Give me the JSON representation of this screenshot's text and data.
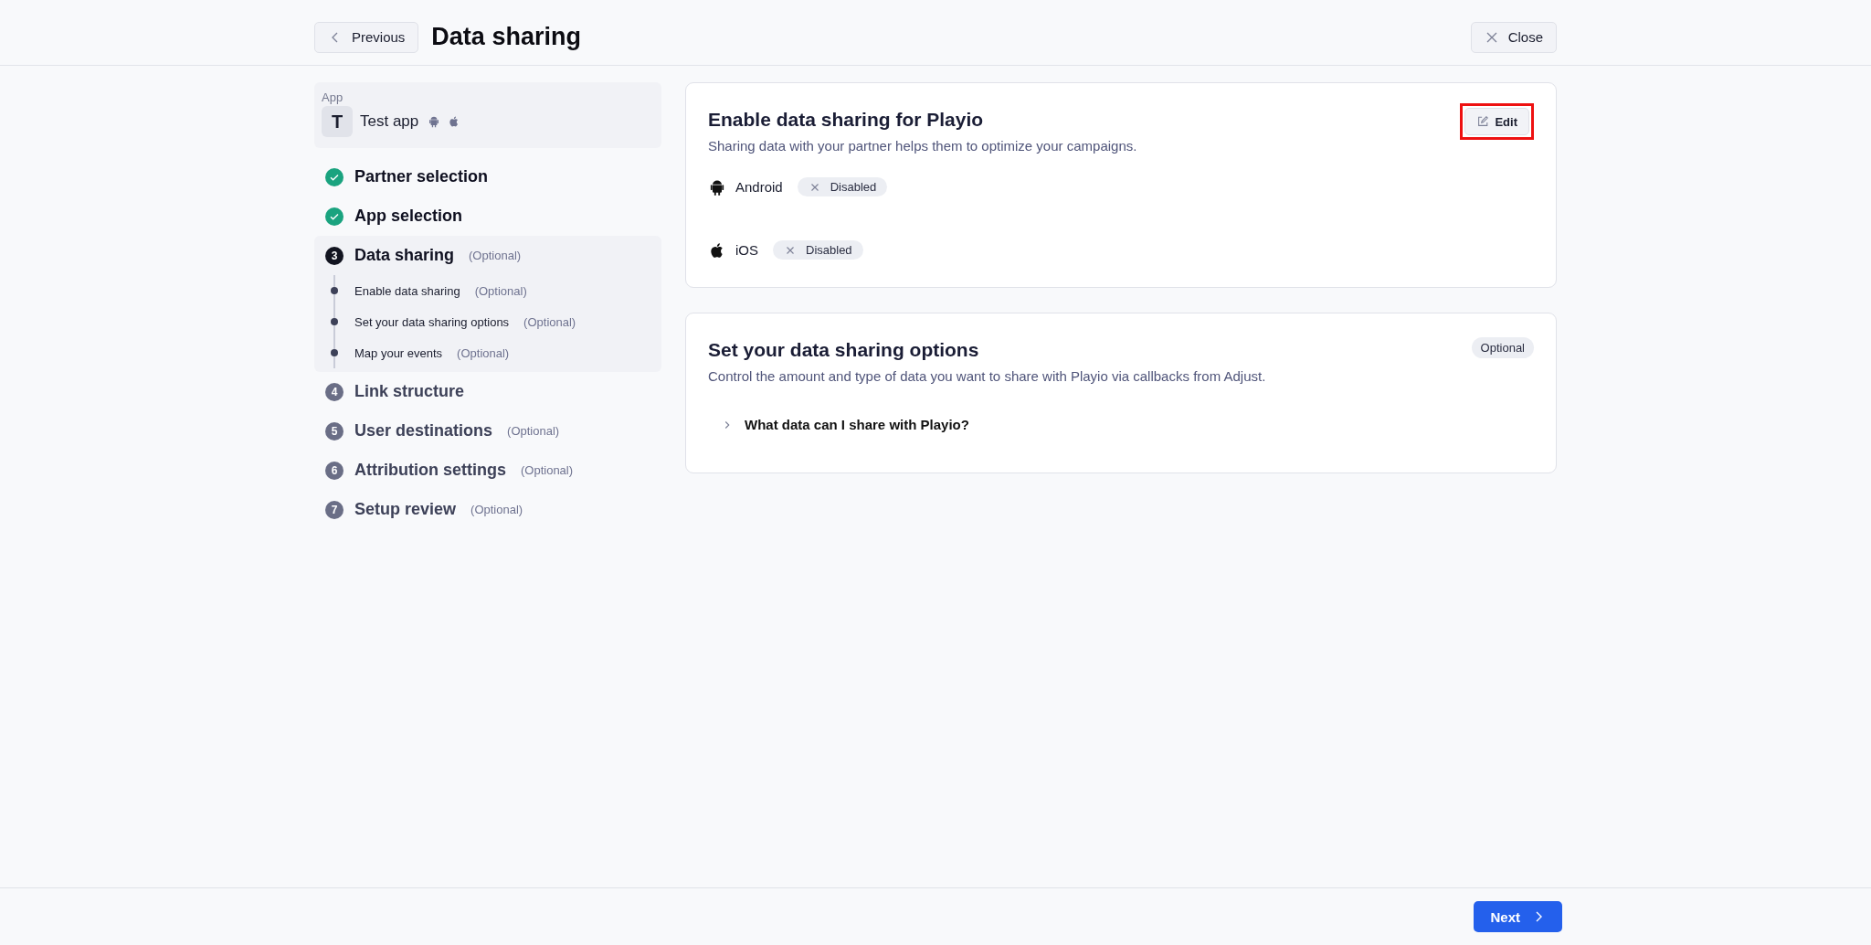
{
  "header": {
    "back_button": "Previous",
    "title": "Data sharing",
    "close_button": "Close"
  },
  "sidebar": {
    "app": {
      "caption": "App",
      "initial": "T",
      "name": "Test app"
    },
    "steps": [
      {
        "label": "Partner selection",
        "completed": true,
        "selected": false
      },
      {
        "label": "App selection",
        "completed": true,
        "selected": false
      },
      {
        "number": "3",
        "label": "Data sharing",
        "optional": "(Optional)",
        "completed": false,
        "selected": true,
        "children": [
          {
            "label": "Enable data sharing",
            "optional": "(Optional)"
          },
          {
            "label": "Set your data sharing options",
            "optional": "(Optional)"
          },
          {
            "label": "Map your events",
            "optional": "(Optional)"
          }
        ]
      },
      {
        "number": "4",
        "label": "Link structure",
        "completed": false,
        "selected": false
      },
      {
        "number": "5",
        "label": "User destinations",
        "optional": "(Optional)",
        "completed": false,
        "selected": false
      },
      {
        "number": "6",
        "label": "Attribution settings",
        "optional": "(Optional)",
        "completed": false,
        "selected": false
      },
      {
        "number": "7",
        "label": "Setup review",
        "optional": "(Optional)",
        "completed": false,
        "selected": false
      }
    ]
  },
  "cards": [
    {
      "kind": "platforms",
      "title": "Enable data sharing for Playio",
      "description": "Sharing data with your partner helps them to optimize your campaigns.",
      "edit_button": {
        "label": "Edit",
        "highlighted": true
      },
      "platforms": [
        {
          "kind": "android",
          "name": "Android",
          "status": "Disabled",
          "enabled": false
        },
        {
          "kind": "ios",
          "name": "iOS",
          "status": "Disabled",
          "enabled": false
        }
      ]
    },
    {
      "kind": "options",
      "title": "Set your data sharing options",
      "description": "Control the amount and type of data you want to share with Playio via callbacks from Adjust.",
      "badge": "Optional",
      "disclosure": {
        "label": "What data can I share with Playio?",
        "expanded": false
      }
    }
  ],
  "footer": {
    "next_button": "Next"
  }
}
